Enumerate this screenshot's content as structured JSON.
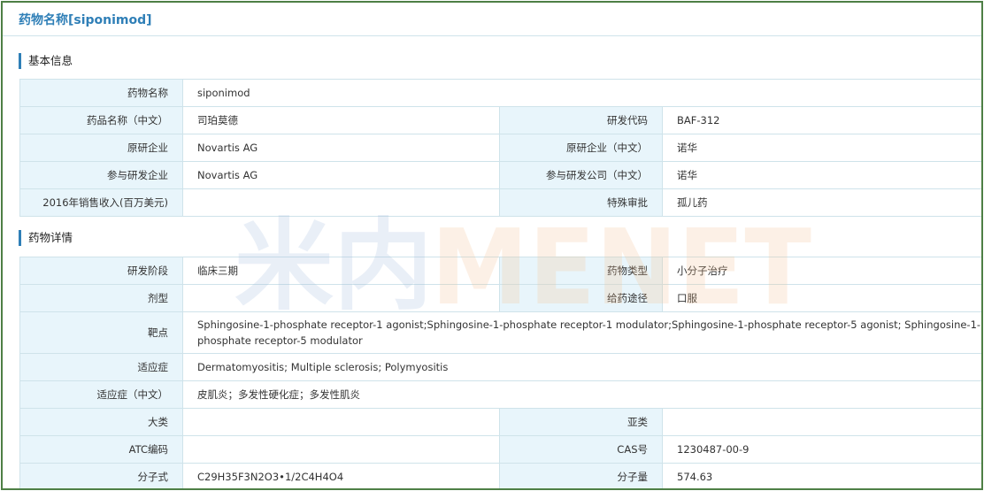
{
  "page_title": "药物名称[siponimod]",
  "basic_section": {
    "title": "基本信息",
    "rows": [
      {
        "l1": "药物名称",
        "v1": "siponimod"
      },
      {
        "l1": "药品名称（中文）",
        "v1": "司珀莫德",
        "l2": "研发代码",
        "v2": "BAF-312"
      },
      {
        "l1": "原研企业",
        "v1": "Novartis AG",
        "l2": "原研企业（中文）",
        "v2": "诺华"
      },
      {
        "l1": "参与研发企业",
        "v1": "Novartis AG",
        "l2": "参与研发公司（中文）",
        "v2": "诺华"
      },
      {
        "l1": "2016年销售收入(百万美元)",
        "v1": "",
        "l2": "特殊审批",
        "v2": "孤儿药"
      }
    ]
  },
  "detail_section": {
    "title": "药物详情",
    "rows": [
      {
        "l1": "研发阶段",
        "v1": "临床三期",
        "l2": "药物类型",
        "v2": "小分子治疗"
      },
      {
        "l1": "剂型",
        "v1": "",
        "l2": "给药途径",
        "v2": "口服"
      },
      {
        "l1": "靶点",
        "v1": "Sphingosine-1-phosphate receptor-1 agonist;Sphingosine-1-phosphate receptor-1 modulator;Sphingosine-1-phosphate receptor-5 agonist; Sphingosine-1-phosphate receptor-5 modulator"
      },
      {
        "l1": "适应症",
        "v1": "Dermatomyositis; Multiple sclerosis; Polymyositis"
      },
      {
        "l1": "适应症（中文）",
        "v1": "皮肌炎；多发性硬化症；多发性肌炎"
      },
      {
        "l1": "大类",
        "v1": "",
        "l2": "亚类",
        "v2": ""
      },
      {
        "l1": "ATC编码",
        "v1": "",
        "l2": "CAS号",
        "v2": "1230487-00-9"
      },
      {
        "l1": "分子式",
        "v1": "C29H35F3N2O3•1/2C4H4O4",
        "l2": "分子量",
        "v2": "574.63"
      }
    ]
  },
  "watermark": {
    "text_cn": "米内",
    "text_en": "MENET",
    "color_cn": "#9fb8dc",
    "color_en": "#f6c08f"
  }
}
